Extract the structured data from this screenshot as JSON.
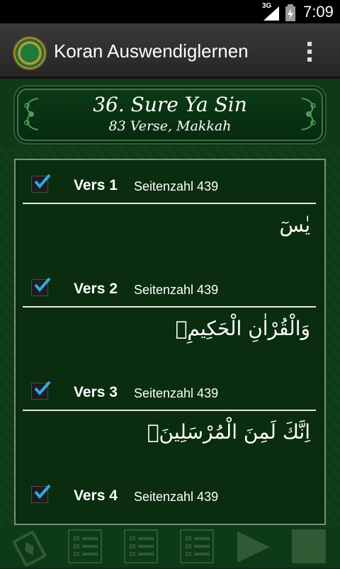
{
  "status_bar": {
    "network": "3G",
    "time": "7:09",
    "signal_icon": "signal-icon",
    "battery_icon": "battery-charging-icon"
  },
  "action_bar": {
    "title": "Koran Auswendiglernen",
    "logo_icon": "quran-logo-icon",
    "menu_icon": "overflow-menu-icon"
  },
  "header": {
    "title": "36. Sure Ya Sin",
    "subtitle": "83 Verse, Makkah"
  },
  "verses": [
    {
      "label": "Vers 1",
      "page": "Seitenzahl 439",
      "arabic": "يٰسٓ",
      "checked": true
    },
    {
      "label": "Vers 2",
      "page": "Seitenzahl 439",
      "arabic": "وَالْقُرْاٰنِ الْحَكِيمِۙ",
      "checked": true
    },
    {
      "label": "Vers 3",
      "page": "Seitenzahl 439",
      "arabic": "اِنَّكَ لَمِنَ الْمُرْسَلِينَۙ",
      "checked": true
    },
    {
      "label": "Vers 4",
      "page": "Seitenzahl 439",
      "arabic": "",
      "checked": true
    }
  ],
  "toolbar": {
    "items": [
      "book-icon",
      "list-icon",
      "list-icon",
      "list-icon",
      "play-icon",
      "stop-icon"
    ]
  },
  "colors": {
    "background": "#0d3a17",
    "panel": "#0a2c0f",
    "check": "#33a9e0",
    "toolbar_icon": "#2e5a34"
  }
}
